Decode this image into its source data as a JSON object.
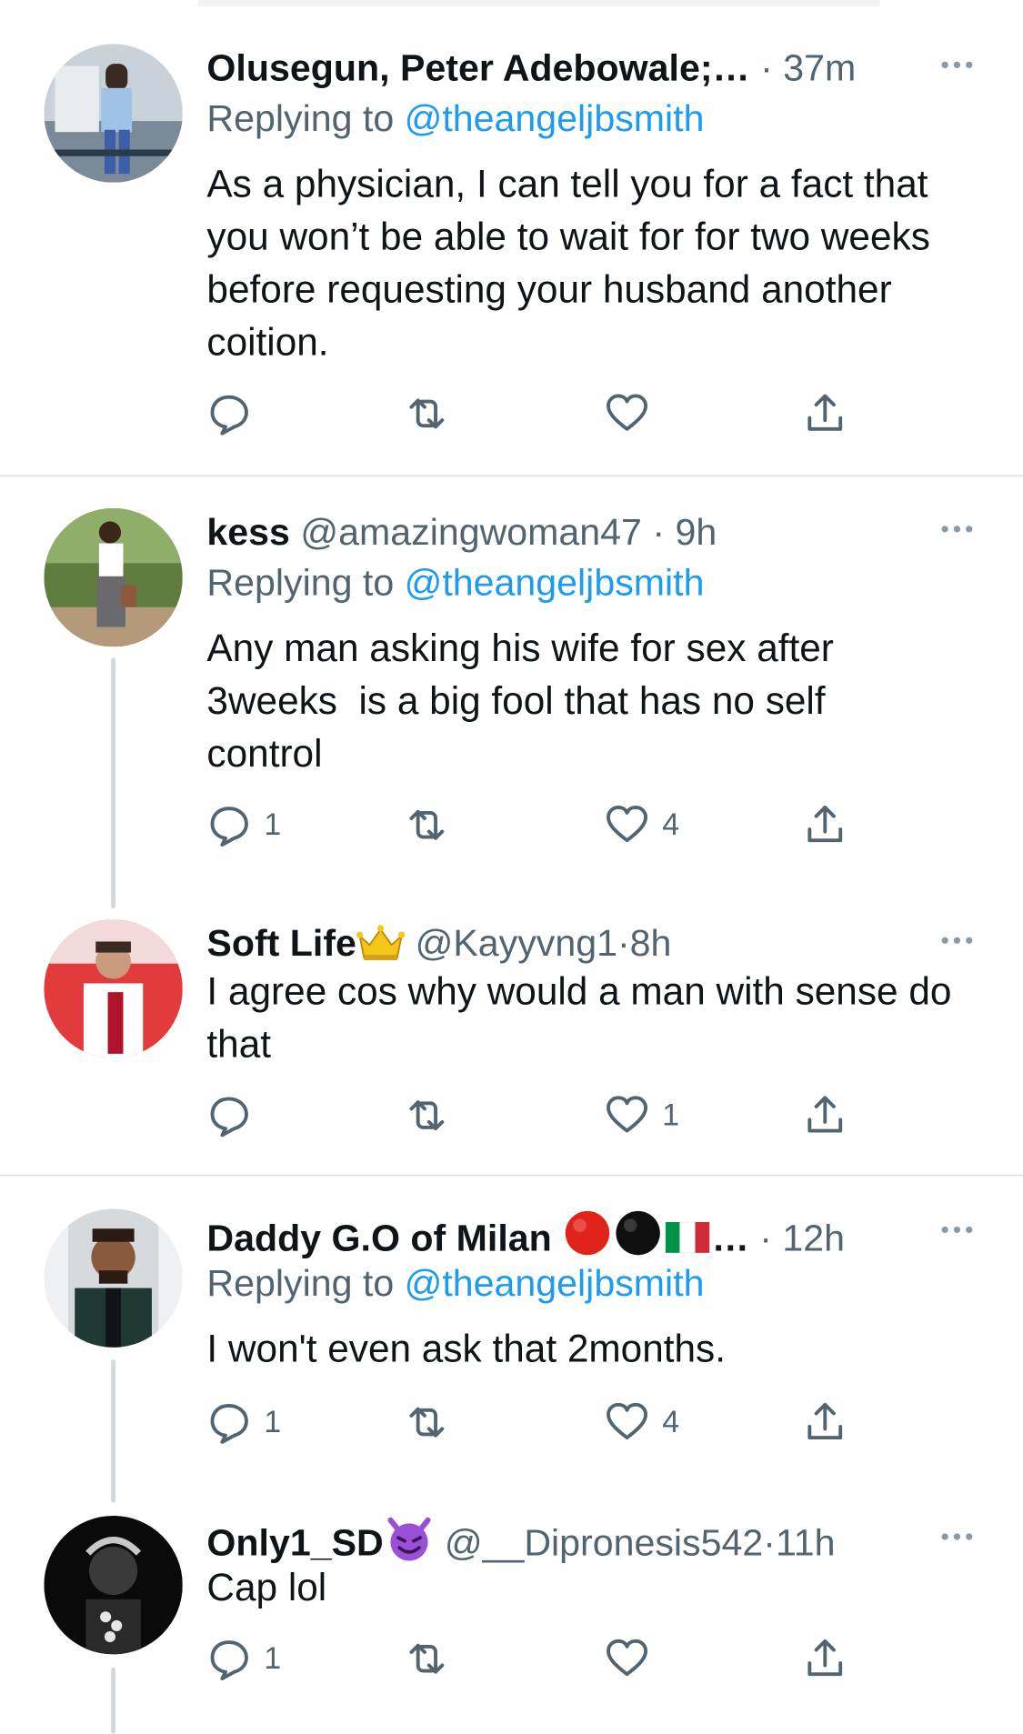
{
  "tweets": [
    {
      "name": "Olusegun, Peter Adebowale;…",
      "handle": "",
      "dot": "·",
      "time": "37m",
      "replying_prefix": "Replying to ",
      "replying_to": "@theangeljbsmith",
      "text": "As a physician, I can tell you for a fact that you won’t be able to wait for for two weeks before requesting your husband another coition.",
      "reply_count": "",
      "like_count": ""
    },
    {
      "name": "kess",
      "handle": "@amazingwoman47",
      "dot": "·",
      "time": "9h",
      "replying_prefix": "Replying to ",
      "replying_to": "@theangeljbsmith",
      "text": "Any man asking his wife for sex after 3weeks  is a big fool that has no self control",
      "reply_count": "1",
      "like_count": "4"
    },
    {
      "name": "Soft Life",
      "handle": "@Kayyvng1",
      "dot": "·",
      "time": "8h",
      "text": "I agree cos why would a man with sense do that",
      "reply_count": "",
      "like_count": "1"
    },
    {
      "name": "Daddy G.O of Milan",
      "name_suffix": "…",
      "handle": "",
      "dot": "·",
      "time": "12h",
      "replying_prefix": "Replying to ",
      "replying_to": "@theangeljbsmith",
      "text": "I won't even ask that 2months.",
      "reply_count": "1",
      "like_count": "4"
    },
    {
      "name": "Only1_SD",
      "handle": "@__Dipronesis542",
      "dot": "·",
      "time": "11h",
      "text": "Cap lol",
      "reply_count": "1",
      "like_count": ""
    }
  ],
  "icons": {
    "reply": "reply-icon",
    "retweet": "retweet-icon",
    "like": "like-icon",
    "share": "share-icon",
    "more": "more-icon"
  },
  "colors": {
    "link": "#1d9bf0",
    "secondary_text": "#536471",
    "primary_text": "#0f1419",
    "thread_line": "#cfd9de"
  }
}
